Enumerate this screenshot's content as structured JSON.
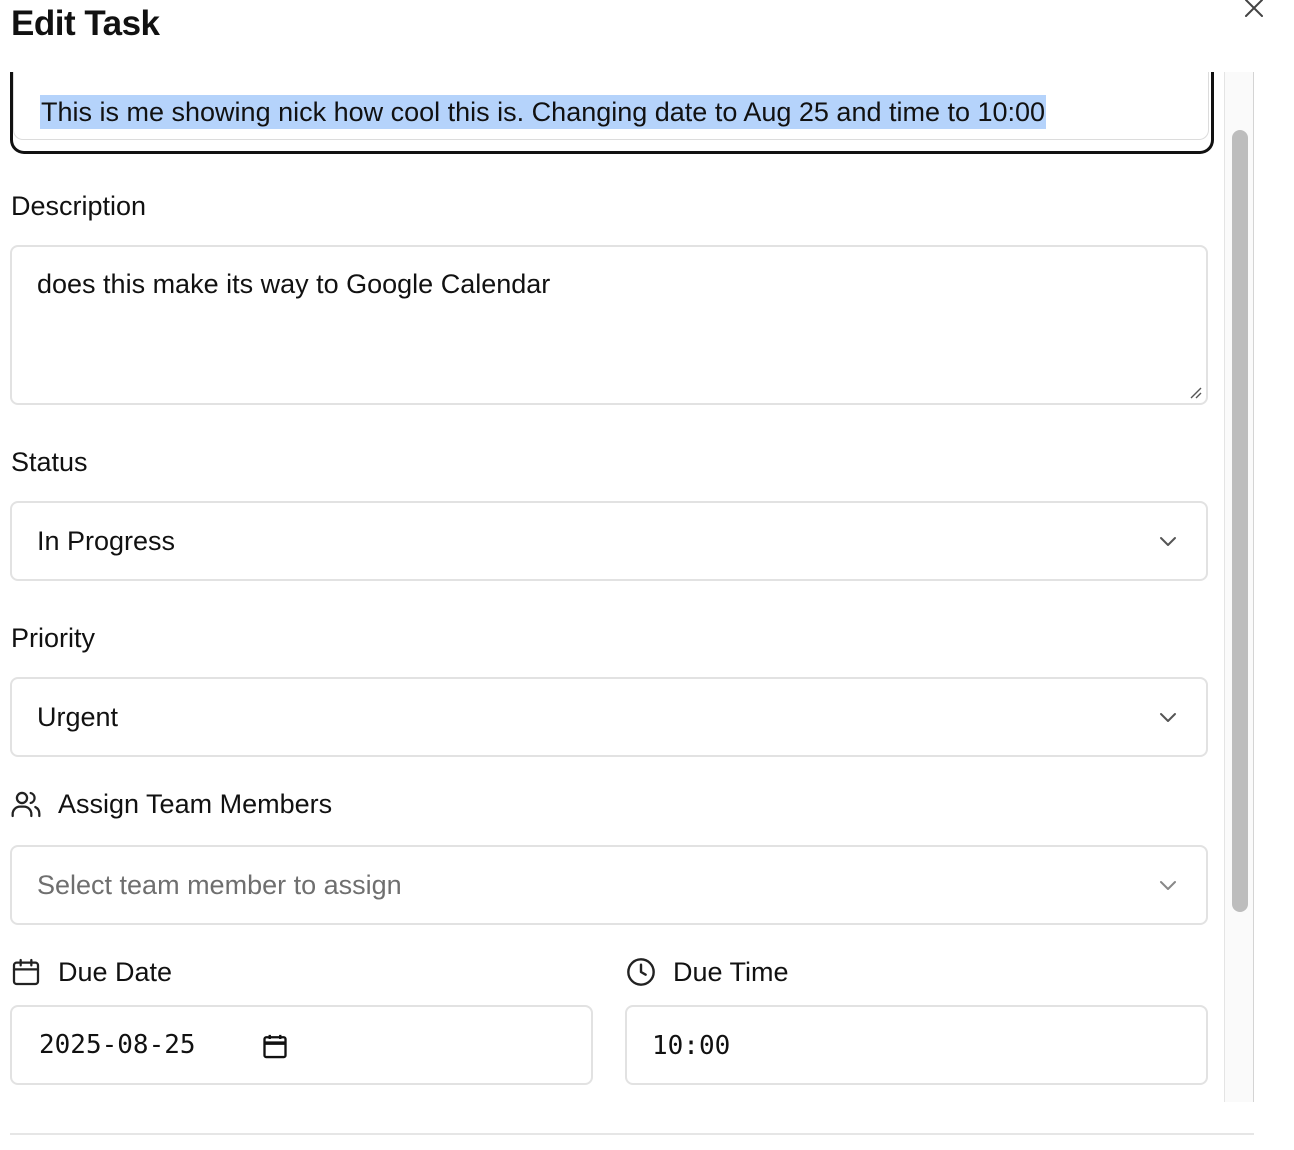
{
  "dialog": {
    "title": "Edit Task",
    "close_icon": "close-icon"
  },
  "title_field": {
    "value": "This is me showing nick how cool this is. Changing date to Aug 25 and time to 10:00"
  },
  "description": {
    "label": "Description",
    "value": "does this make its way to Google Calendar"
  },
  "status": {
    "label": "Status",
    "selected": "In Progress"
  },
  "priority": {
    "label": "Priority",
    "selected": "Urgent"
  },
  "team": {
    "label": "Assign Team Members",
    "icon": "users-icon",
    "placeholder": "Select team member to assign"
  },
  "due_date": {
    "label": "Due Date",
    "icon": "calendar-icon",
    "value": "2025-08-25"
  },
  "due_time": {
    "label": "Due Time",
    "icon": "clock-icon",
    "value": "10:00"
  },
  "colors": {
    "selection_highlight": "#b5d3fb",
    "border": "#e2e2e2",
    "focus_border": "#111111",
    "scrollbar_thumb": "#bdbdbd"
  }
}
